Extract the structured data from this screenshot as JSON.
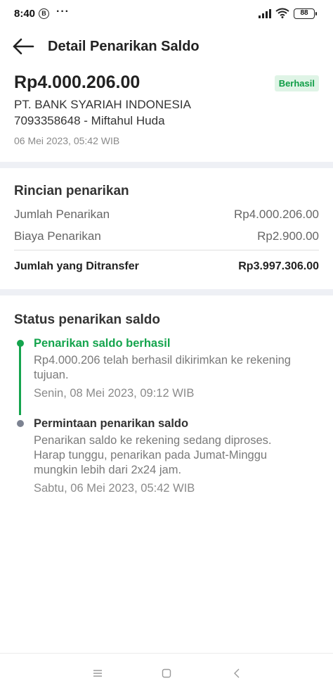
{
  "status_bar": {
    "time": "8:40",
    "b_badge": "B",
    "dots": "···",
    "battery": "88",
    "icons": [
      "signal-icon",
      "wifi-icon",
      "battery-icon"
    ]
  },
  "header": {
    "title": "Detail Penarikan Saldo",
    "back_icon": "arrow-left-icon"
  },
  "summary": {
    "amount": "Rp4.000.206.00",
    "status_badge": "Berhasil",
    "bank_name": "PT. BANK SYARIAH INDONESIA",
    "account": "7093358648 - Miftahul Huda",
    "date": "06 Mei 2023, 05:42 WIB"
  },
  "details": {
    "title": "Rincian penarikan",
    "rows": [
      {
        "label": "Jumlah Penarikan",
        "value": "Rp4.000.206.00"
      },
      {
        "label": "Biaya Penarikan",
        "value": "Rp2.900.00"
      }
    ],
    "total": {
      "label": "Jumlah yang Ditransfer",
      "value": "Rp3.997.306.00"
    }
  },
  "status": {
    "title": "Status penarikan saldo",
    "steps": [
      {
        "heading": "Penarikan saldo berhasil",
        "body_lines": [
          "Rp4.000.206 telah berhasil dikirimkan ke rekening",
          "tujuan."
        ],
        "date": "Senin, 08 Mei 2023, 09:12 WIB"
      },
      {
        "heading": "Permintaan penarikan saldo",
        "body_lines": [
          "Penarikan saldo ke rekening sedang diproses.",
          "Harap tunggu, penarikan pada Jumat-Minggu",
          "mungkin lebih dari 2x24 jam."
        ],
        "date": "Sabtu, 06 Mei 2023, 05:42 WIB"
      }
    ]
  },
  "colors": {
    "accent_green": "#14a44d",
    "badge_bg": "#dff4e6",
    "pending_gray": "#7c8291",
    "band": "#eef0f5"
  },
  "nav_bar": {
    "icons": [
      "menu-icon",
      "home-square-icon",
      "back-chevron-icon"
    ]
  }
}
